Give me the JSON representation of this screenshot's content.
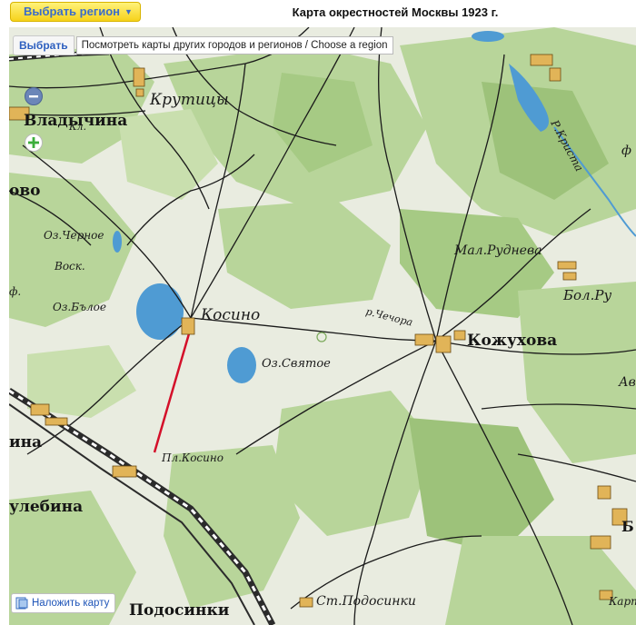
{
  "header": {
    "region_button_label": "Выбрать регион",
    "title": "Карта окрестностей Москвы 1923 г."
  },
  "map_controls": {
    "choose_label": "Выбрать",
    "choose_tooltip": "Посмотреть карты других городов и регионов / Choose a region",
    "overlay_label": "Наложить карту"
  },
  "places": {
    "kl": "Кл.",
    "krutitsy": "Крутицы",
    "vladychina": "Владычина",
    "ovo": "ово",
    "oz_chernoe": "Оз.Черное",
    "vosk": "Воск.",
    "f": "ф.",
    "oz_beloe": "Оз.Бълое",
    "kosino": "Косино",
    "oz_svyatoe": "Оз.Святое",
    "r_chechora": "р.Чечора",
    "kozhukhova": "Кожухова",
    "mal_rudneva": "Мал.Руднева",
    "bol_ru": "Бол.Ру",
    "r_krista": "Р.Криста",
    "pl_kosino": "Пл.Косино",
    "ina": "ина",
    "ulebina": "улебина",
    "podosinki": "Подосинки",
    "st_podosinki": "Ст.Подосинки",
    "av": "Ав",
    "kart": "Карт",
    "b": "Б",
    "fi": "ф"
  },
  "colors": {
    "map_base": "#e9ece0",
    "forest": "#b8d59a",
    "forest_dark": "#9dc27a",
    "water": "#4f9bd3",
    "road": "#1a1a1a",
    "rail": "#2b2b2b",
    "highlight_line": "#d4102a",
    "settlement": "#e1b458"
  },
  "icons": {
    "zoom_out": "minus-icon",
    "zoom_in": "plus-icon",
    "dropdown": "caret-down-icon",
    "choose": "map-pin-icon",
    "overlay": "layers-icon"
  }
}
